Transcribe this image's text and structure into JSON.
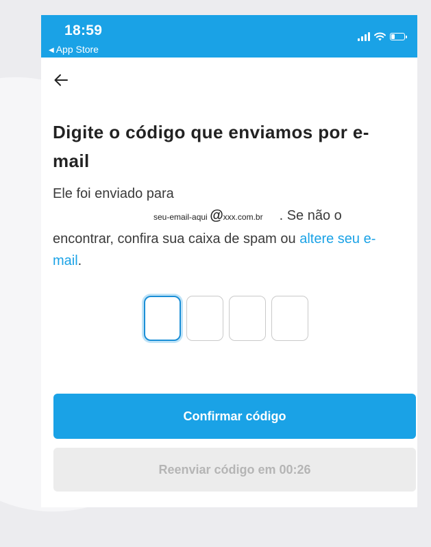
{
  "status_bar": {
    "time": "18:59",
    "back_app_label": "App Store",
    "battery_level": 0.3
  },
  "header": {
    "back_icon": "arrow-left-icon"
  },
  "main": {
    "title": "Digite o código que enviamos por e-mail",
    "description_prefix": "Ele foi enviado para",
    "email_user": "seu-email-aqui",
    "email_at": "@",
    "email_domain": "xxx.com.br",
    "description_middle": ". Se não o encontrar, confira sua caixa de spam ou ",
    "change_email_link": "altere seu e-mail",
    "description_end": ".",
    "code_length": 4,
    "active_index": 0
  },
  "actions": {
    "confirm_label": "Confirmar código",
    "resend_label": "Reenviar código em 00:26"
  },
  "colors": {
    "accent": "#1aa2e6",
    "disabled_bg": "#ececec",
    "disabled_text": "#b5b5b5",
    "title_text": "#222222"
  }
}
